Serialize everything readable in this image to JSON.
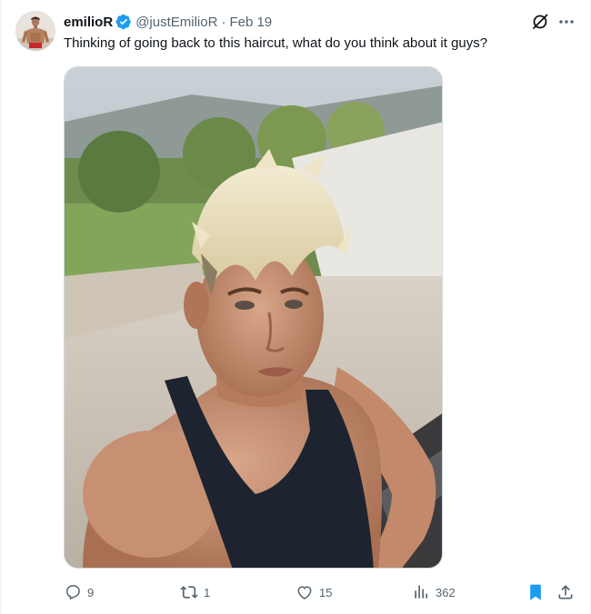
{
  "tweet": {
    "author": {
      "display_name": "emilioR",
      "handle": "@justEmilioR",
      "verified": true,
      "avatar_icon": "profile-photo"
    },
    "separator": "·",
    "date": "Feb 19",
    "text": "Thinking of going back to this haircut, what do you think about it guys?",
    "media": {
      "type": "photo"
    },
    "stats": {
      "replies": "9",
      "reposts": "1",
      "likes": "15",
      "views": "362"
    },
    "bookmarked": true
  },
  "colors": {
    "text_primary": "#0f1419",
    "text_secondary": "#536471",
    "verified_blue": "#1d9bf0",
    "bookmark_blue": "#1d9bf0"
  }
}
